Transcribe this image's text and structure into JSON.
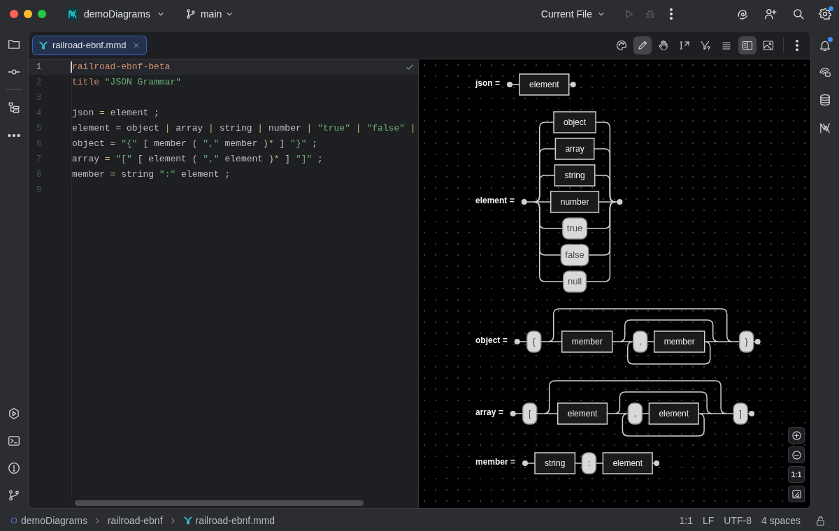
{
  "title_bar": {
    "project": "demoDiagrams",
    "branch": "main",
    "run_configuration": "Current File"
  },
  "run_controls": [
    {
      "kind": "run",
      "disabled": true
    },
    {
      "kind": "debug",
      "disabled": true
    }
  ],
  "editor_tab": {
    "label": "railroad-ebnf.mmd",
    "selected": true
  },
  "preview_toolbar": [
    {
      "kind": "palette",
      "selected": false
    },
    {
      "kind": "pencil",
      "selected": true
    },
    {
      "kind": "hand",
      "selected": false
    },
    {
      "kind": "text_cursor",
      "selected": false
    },
    {
      "kind": "filter",
      "selected": false
    },
    {
      "kind": "lines",
      "selected": false
    },
    {
      "kind": "split",
      "selected": true
    },
    {
      "kind": "image",
      "selected": false
    }
  ],
  "code_lines": [
    {
      "number": "1",
      "current": true,
      "tokens": [
        {
          "kind": "keyword",
          "text": "railroad-ebnf-beta"
        }
      ]
    },
    {
      "number": "2",
      "current": false,
      "tokens": [
        {
          "kind": "keyword",
          "text": "title "
        },
        {
          "kind": "string",
          "text": "\"JSON Grammar\""
        }
      ]
    },
    {
      "number": "3",
      "current": false
    },
    {
      "number": "4",
      "current": false,
      "tokens": [
        {
          "kind": "plain",
          "text": "json "
        },
        {
          "kind": "operator",
          "text": "="
        },
        {
          "kind": "plain",
          "text": " element ;"
        }
      ]
    },
    {
      "number": "5",
      "current": false,
      "tokens": [
        {
          "kind": "plain",
          "text": "element "
        },
        {
          "kind": "operator",
          "text": "="
        },
        {
          "kind": "plain",
          "text": " object "
        },
        {
          "kind": "operator",
          "text": "|"
        },
        {
          "kind": "plain",
          "text": " array "
        },
        {
          "kind": "operator",
          "text": "|"
        },
        {
          "kind": "plain",
          "text": " string "
        },
        {
          "kind": "operator",
          "text": "|"
        },
        {
          "kind": "plain",
          "text": " number "
        },
        {
          "kind": "operator",
          "text": "| "
        },
        {
          "kind": "string",
          "text": "\"true\""
        },
        {
          "kind": "operator",
          "text": " | "
        },
        {
          "kind": "string",
          "text": "\"false\""
        },
        {
          "kind": "operator",
          "text": " |"
        }
      ]
    },
    {
      "number": "6",
      "current": false,
      "tokens": [
        {
          "kind": "plain",
          "text": "object "
        },
        {
          "kind": "operator",
          "text": "="
        },
        {
          "kind": "string",
          "text": " \"{\""
        },
        {
          "kind": "plain",
          "text": " [ member ( "
        },
        {
          "kind": "string",
          "text": "\",\""
        },
        {
          "kind": "plain",
          "text": " member )"
        },
        {
          "kind": "operator",
          "text": "*"
        },
        {
          "kind": "plain",
          "text": " ] "
        },
        {
          "kind": "string",
          "text": "\"}\""
        },
        {
          "kind": "plain",
          "text": " ;"
        }
      ]
    },
    {
      "number": "7",
      "current": false,
      "tokens": [
        {
          "kind": "plain",
          "text": "array "
        },
        {
          "kind": "operator",
          "text": "="
        },
        {
          "kind": "string",
          "text": " \"[\""
        },
        {
          "kind": "plain",
          "text": " [ element ( "
        },
        {
          "kind": "string",
          "text": "\",\""
        },
        {
          "kind": "plain",
          "text": " element )"
        },
        {
          "kind": "operator",
          "text": "*"
        },
        {
          "kind": "plain",
          "text": " ] "
        },
        {
          "kind": "string",
          "text": "\"]\""
        },
        {
          "kind": "plain",
          "text": " ;"
        }
      ]
    },
    {
      "number": "8",
      "current": false,
      "tokens": [
        {
          "kind": "plain",
          "text": "member "
        },
        {
          "kind": "operator",
          "text": "="
        },
        {
          "kind": "plain",
          "text": " string "
        },
        {
          "kind": "string",
          "text": "\":\""
        },
        {
          "kind": "plain",
          "text": " element ;"
        }
      ]
    },
    {
      "number": "9",
      "current": false
    }
  ],
  "diagram": {
    "rules": [
      {
        "label": "json =",
        "body": {
          "kind": "nonterminal",
          "text": "element"
        }
      },
      {
        "label": "element =",
        "body": {
          "kind": "choice",
          "items": [
            {
              "kind": "nonterminal",
              "text": "object"
            },
            {
              "kind": "nonterminal",
              "text": "array"
            },
            {
              "kind": "nonterminal",
              "text": "string"
            },
            {
              "kind": "nonterminal",
              "text": "number"
            },
            {
              "kind": "terminal",
              "text": "true"
            },
            {
              "kind": "terminal",
              "text": "false"
            },
            {
              "kind": "terminal",
              "text": "null"
            }
          ]
        }
      },
      {
        "label": "object =",
        "body": {
          "kind": "sequence",
          "items": [
            {
              "kind": "terminal",
              "text": "{"
            },
            {
              "kind": "optional",
              "item": {
                "kind": "sequence",
                "items": [
                  {
                    "kind": "nonterminal",
                    "text": "member"
                  },
                  {
                    "kind": "zero_or_more",
                    "item": {
                      "kind": "sequence",
                      "items": [
                        {
                          "kind": "terminal",
                          "text": ","
                        },
                        {
                          "kind": "nonterminal",
                          "text": "member"
                        }
                      ]
                    }
                  }
                ]
              }
            },
            {
              "kind": "terminal",
              "text": "}"
            }
          ]
        }
      },
      {
        "label": "array =",
        "body": {
          "kind": "sequence",
          "items": [
            {
              "kind": "terminal",
              "text": "["
            },
            {
              "kind": "optional",
              "item": {
                "kind": "sequence",
                "items": [
                  {
                    "kind": "nonterminal",
                    "text": "element"
                  },
                  {
                    "kind": "zero_or_more",
                    "item": {
                      "kind": "sequence",
                      "items": [
                        {
                          "kind": "terminal",
                          "text": ","
                        },
                        {
                          "kind": "nonterminal",
                          "text": "element"
                        }
                      ]
                    }
                  }
                ]
              }
            },
            {
              "kind": "terminal",
              "text": "]"
            }
          ]
        }
      },
      {
        "label": "member =",
        "body": {
          "kind": "sequence",
          "items": [
            {
              "kind": "nonterminal",
              "text": "string"
            },
            {
              "kind": "terminal",
              "text": ":"
            },
            {
              "kind": "nonterminal",
              "text": "element"
            }
          ]
        }
      }
    ]
  },
  "zoom_controls": [
    {
      "kind": "zoom_in"
    },
    {
      "kind": "zoom_out"
    },
    {
      "kind": "actual_size",
      "label": "1:1"
    },
    {
      "kind": "fit"
    }
  ],
  "breadcrumbs": [
    "demoDiagrams",
    "railroad-ebnf",
    "railroad-ebnf.mmd"
  ],
  "status_items": [
    "1:1",
    "LF",
    "UTF-8",
    "4 spaces"
  ]
}
